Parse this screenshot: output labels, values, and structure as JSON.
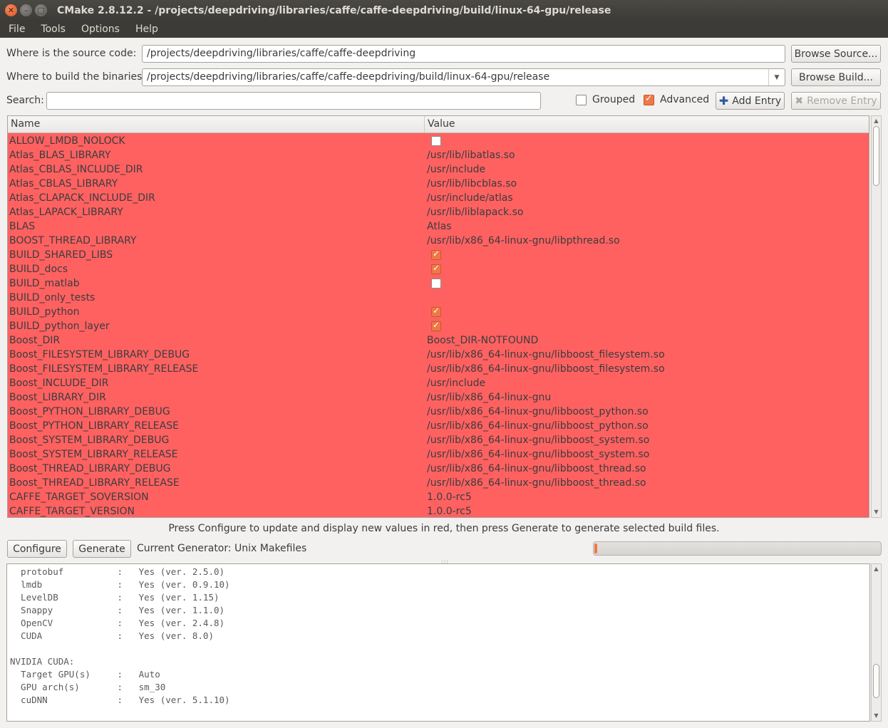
{
  "window": {
    "title": "CMake 2.8.12.2 - /projects/deepdriving/libraries/caffe/caffe-deepdriving/build/linux-64-gpu/release"
  },
  "menu": [
    "File",
    "Tools",
    "Options",
    "Help"
  ],
  "source": {
    "label": "Where is the source code:",
    "value": "/projects/deepdriving/libraries/caffe/caffe-deepdriving",
    "browse_label": "Browse Source..."
  },
  "build": {
    "label": "Where to build the binaries:",
    "value": "/projects/deepdriving/libraries/caffe/caffe-deepdriving/build/linux-64-gpu/release",
    "browse_label": "Browse Build..."
  },
  "search": {
    "label": "Search:",
    "value": ""
  },
  "options": {
    "grouped_label": "Grouped",
    "grouped_checked": false,
    "advanced_label": "Advanced",
    "advanced_checked": true,
    "add_entry_label": "Add Entry",
    "remove_entry_label": "Remove Entry"
  },
  "table": {
    "headers": [
      "Name",
      "Value"
    ],
    "highlight_color": "#ff6161",
    "rows": [
      {
        "name": "ALLOW_LMDB_NOLOCK",
        "value": "",
        "type": "bool",
        "checked": false
      },
      {
        "name": "Atlas_BLAS_LIBRARY",
        "value": "/usr/lib/libatlas.so",
        "type": "text"
      },
      {
        "name": "Atlas_CBLAS_INCLUDE_DIR",
        "value": "/usr/include",
        "type": "text"
      },
      {
        "name": "Atlas_CBLAS_LIBRARY",
        "value": "/usr/lib/libcblas.so",
        "type": "text"
      },
      {
        "name": "Atlas_CLAPACK_INCLUDE_DIR",
        "value": "/usr/include/atlas",
        "type": "text"
      },
      {
        "name": "Atlas_LAPACK_LIBRARY",
        "value": "/usr/lib/liblapack.so",
        "type": "text"
      },
      {
        "name": "BLAS",
        "value": "Atlas",
        "type": "text"
      },
      {
        "name": "BOOST_THREAD_LIBRARY",
        "value": "/usr/lib/x86_64-linux-gnu/libpthread.so",
        "type": "text"
      },
      {
        "name": "BUILD_SHARED_LIBS",
        "value": "",
        "type": "bool",
        "checked": true
      },
      {
        "name": "BUILD_docs",
        "value": "",
        "type": "bool",
        "checked": true
      },
      {
        "name": "BUILD_matlab",
        "value": "",
        "type": "bool",
        "checked": false
      },
      {
        "name": "BUILD_only_tests",
        "value": "",
        "type": "text"
      },
      {
        "name": "BUILD_python",
        "value": "",
        "type": "bool",
        "checked": true
      },
      {
        "name": "BUILD_python_layer",
        "value": "",
        "type": "bool",
        "checked": true
      },
      {
        "name": "Boost_DIR",
        "value": "Boost_DIR-NOTFOUND",
        "type": "text"
      },
      {
        "name": "Boost_FILESYSTEM_LIBRARY_DEBUG",
        "value": "/usr/lib/x86_64-linux-gnu/libboost_filesystem.so",
        "type": "text"
      },
      {
        "name": "Boost_FILESYSTEM_LIBRARY_RELEASE",
        "value": "/usr/lib/x86_64-linux-gnu/libboost_filesystem.so",
        "type": "text"
      },
      {
        "name": "Boost_INCLUDE_DIR",
        "value": "/usr/include",
        "type": "text"
      },
      {
        "name": "Boost_LIBRARY_DIR",
        "value": "/usr/lib/x86_64-linux-gnu",
        "type": "text"
      },
      {
        "name": "Boost_PYTHON_LIBRARY_DEBUG",
        "value": "/usr/lib/x86_64-linux-gnu/libboost_python.so",
        "type": "text"
      },
      {
        "name": "Boost_PYTHON_LIBRARY_RELEASE",
        "value": "/usr/lib/x86_64-linux-gnu/libboost_python.so",
        "type": "text"
      },
      {
        "name": "Boost_SYSTEM_LIBRARY_DEBUG",
        "value": "/usr/lib/x86_64-linux-gnu/libboost_system.so",
        "type": "text"
      },
      {
        "name": "Boost_SYSTEM_LIBRARY_RELEASE",
        "value": "/usr/lib/x86_64-linux-gnu/libboost_system.so",
        "type": "text"
      },
      {
        "name": "Boost_THREAD_LIBRARY_DEBUG",
        "value": "/usr/lib/x86_64-linux-gnu/libboost_thread.so",
        "type": "text"
      },
      {
        "name": "Boost_THREAD_LIBRARY_RELEASE",
        "value": "/usr/lib/x86_64-linux-gnu/libboost_thread.so",
        "type": "text"
      },
      {
        "name": "CAFFE_TARGET_SOVERSION",
        "value": "1.0.0-rc5",
        "type": "text"
      },
      {
        "name": "CAFFE_TARGET_VERSION",
        "value": "1.0.0-rc5",
        "type": "text"
      }
    ]
  },
  "status_text": "Press Configure to update and display new values in red, then press Generate to generate selected build files.",
  "configure_label": "Configure",
  "generate_label": "Generate",
  "generator_text": "Current Generator: Unix Makefiles",
  "progress": 0.01,
  "output_lines": [
    "  protobuf          :   Yes (ver. 2.5.0)",
    "  lmdb              :   Yes (ver. 0.9.10)",
    "  LevelDB           :   Yes (ver. 1.15)",
    "  Snappy            :   Yes (ver. 1.1.0)",
    "  OpenCV            :   Yes (ver. 2.4.8)",
    "  CUDA              :   Yes (ver. 8.0)",
    "",
    "NVIDIA CUDA:",
    "  Target GPU(s)     :   Auto",
    "  GPU arch(s)       :   sm_30",
    "  cuDNN             :   Yes (ver. 5.1.10)"
  ]
}
